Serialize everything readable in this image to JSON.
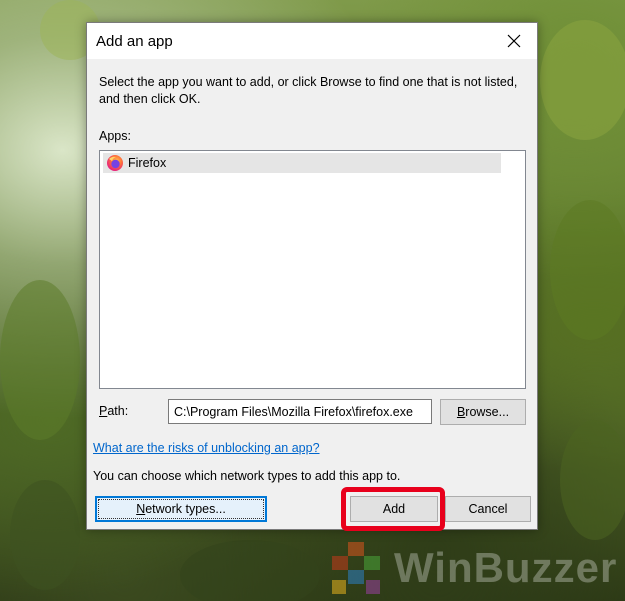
{
  "dialog": {
    "title": "Add an app",
    "instructions": "Select the app you want to add, or click Browse to find one that is not listed, and then click OK.",
    "apps_label": "Apps:",
    "apps": [
      {
        "name": "Firefox",
        "icon": "firefox-icon",
        "selected": true
      }
    ],
    "path_label_mnemonic": "P",
    "path_label_rest": "ath:",
    "path_value": "C:\\Program Files\\Mozilla Firefox\\firefox.exe",
    "browse_mnemonic": "B",
    "browse_rest": "rowse...",
    "risk_link": "What are the risks of unblocking an app?",
    "network_text": "You can choose which network types to add this app to.",
    "network_mnemonic": "N",
    "network_rest": "etwork types...",
    "add_label": "Add",
    "cancel_label": "Cancel"
  },
  "watermark": {
    "text": "WinBuzzer"
  },
  "colors": {
    "highlight": "#e8001c",
    "link": "#0066cc",
    "focus": "#0078d7"
  }
}
